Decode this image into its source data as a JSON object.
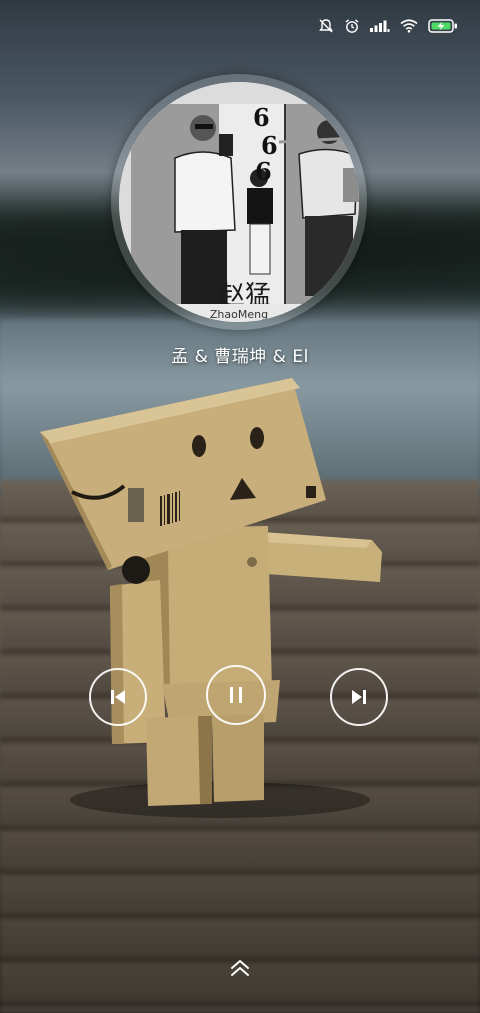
{
  "status_bar": {
    "icons": [
      "bell-muted-icon",
      "alarm-icon",
      "signal-icon",
      "wifi-icon",
      "battery-charging-icon"
    ],
    "battery_color": "#4cd964"
  },
  "album": {
    "brand_text": "ZhaoMeng",
    "calligraphy_text": "赵猛",
    "numbers_text": "666"
  },
  "track": {
    "artists_line": "孟 & 曹瑞坤 & El"
  },
  "controls": {
    "previous_icon": "skip-previous-icon",
    "play_pause_icon": "pause-icon",
    "next_icon": "skip-next-icon",
    "expand_icon": "chevron-up-double-icon"
  }
}
